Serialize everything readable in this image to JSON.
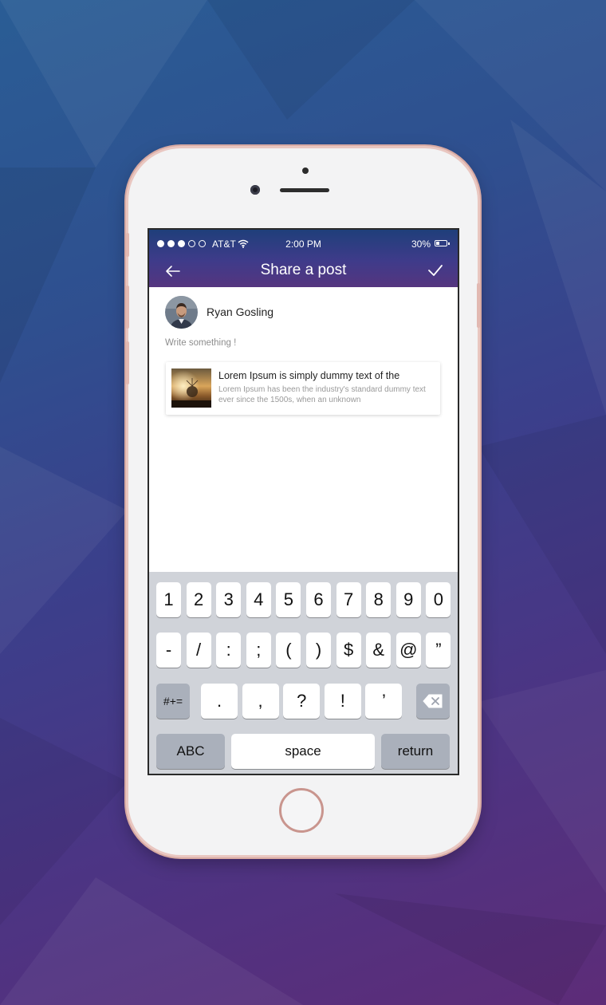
{
  "status_bar": {
    "carrier": "AT&T",
    "time": "2:00 PM",
    "battery": "30%",
    "battery_level": 0.3,
    "signal_bars_filled": 3,
    "signal_bars_total": 5
  },
  "header": {
    "title": "Share a post",
    "back_icon": "arrow-left-icon",
    "done_icon": "checkmark-icon"
  },
  "post": {
    "author_name": "Ryan Gosling",
    "placeholder": "Write something !"
  },
  "shared_link": {
    "title": "Lorem Ipsum is simply dummy text of the",
    "description": "Lorem Ipsum has been the industry's standard dummy text ever since the 1500s, when an unknown"
  },
  "keyboard": {
    "row1": [
      "1",
      "2",
      "3",
      "4",
      "5",
      "6",
      "7",
      "8",
      "9",
      "0"
    ],
    "row2": [
      "-",
      "/",
      ":",
      ";",
      "(",
      ")",
      "$",
      "&",
      "@",
      "”"
    ],
    "row3_mode": "#+=",
    "row3": [
      ".",
      ",",
      "?",
      "!",
      "’"
    ],
    "backspace_icon": "backspace-icon",
    "abc": "ABC",
    "space": "space",
    "return": "return"
  },
  "colors": {
    "header_top": "#1f3f7a",
    "header_bottom": "#55357f",
    "keyboard_bg": "#d0d3d9",
    "phone_frame": "#e9c7c1"
  }
}
